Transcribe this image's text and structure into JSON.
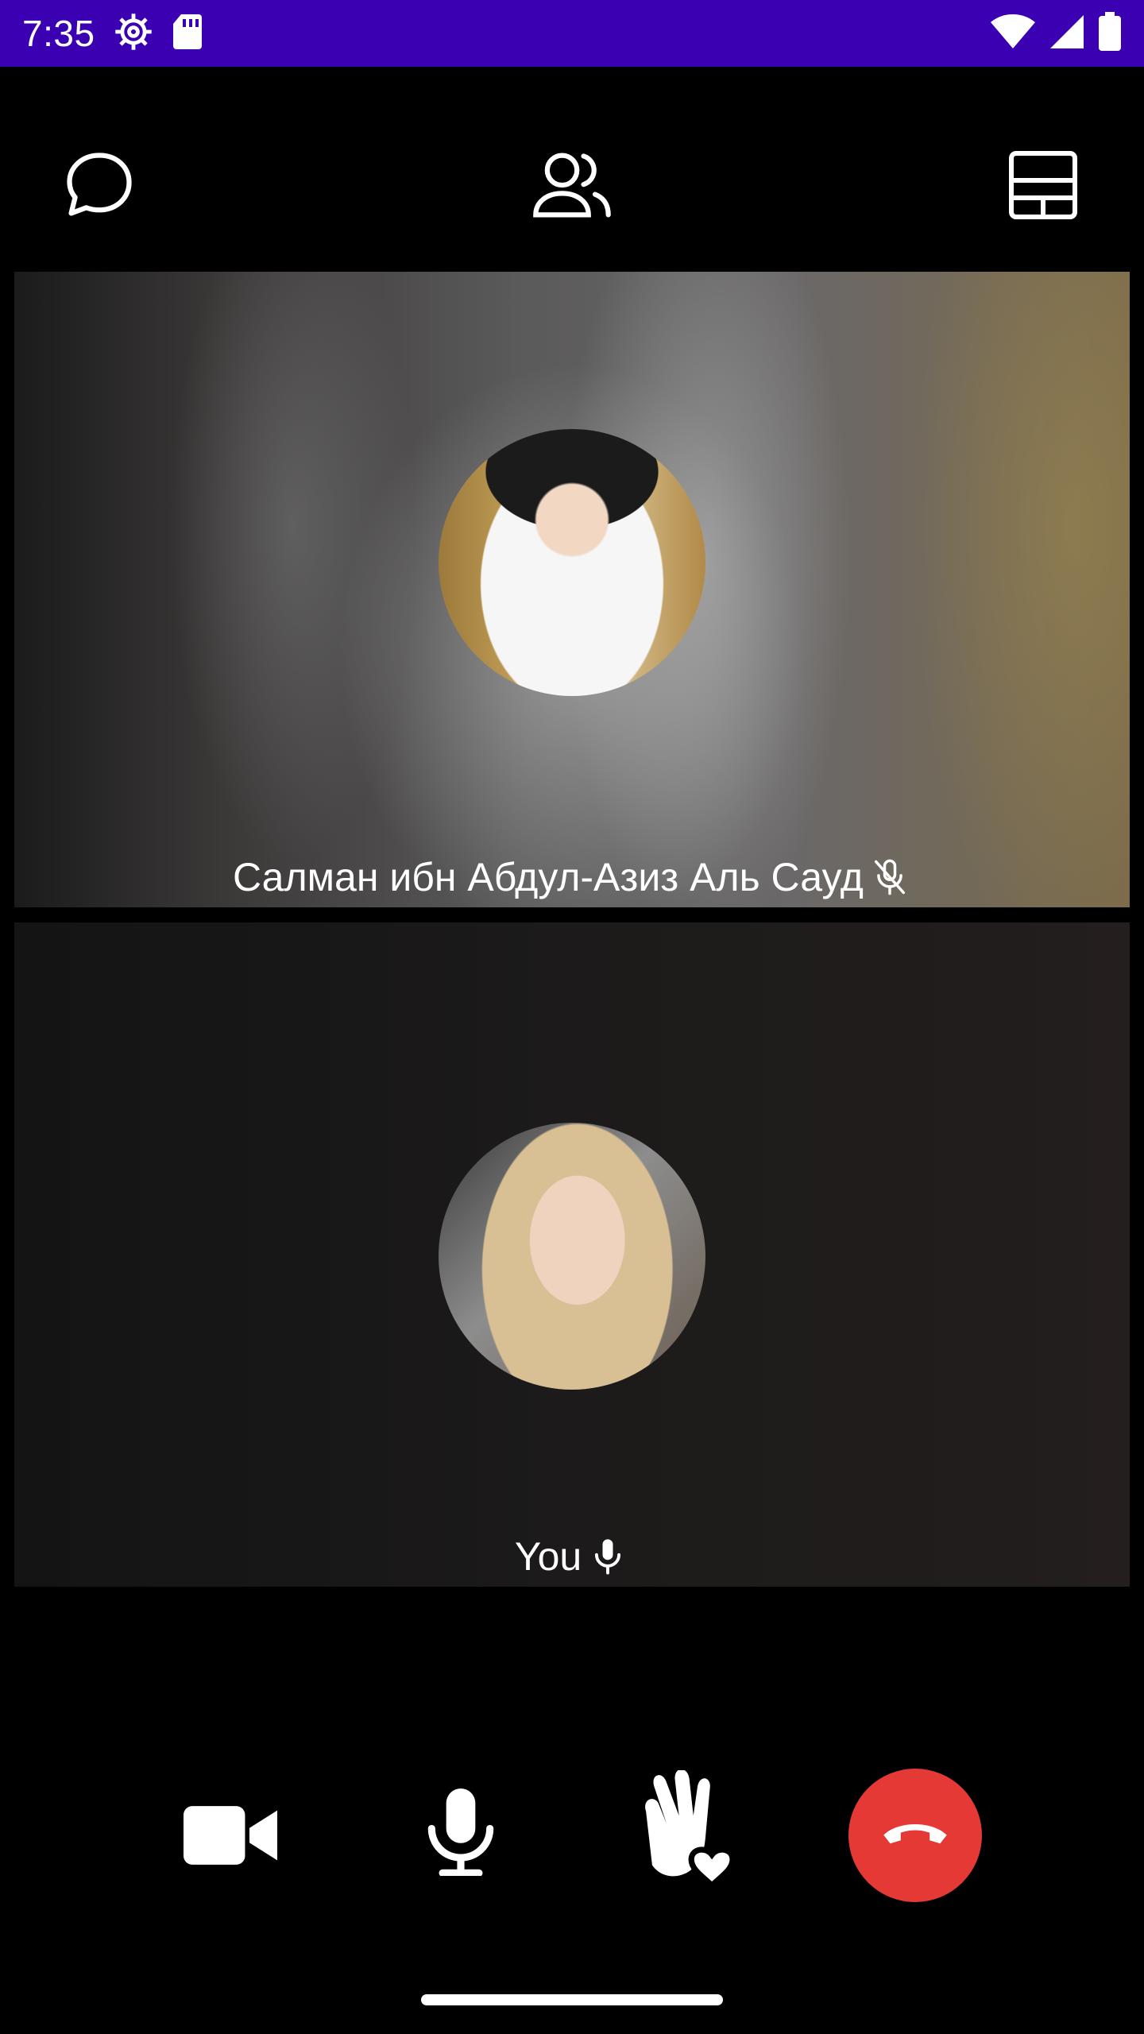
{
  "status": {
    "time": "7:35",
    "left_icons": [
      "settings-gear-icon",
      "sd-card-icon"
    ],
    "right_icons": [
      "wifi-icon",
      "cell-signal-icon",
      "battery-icon"
    ]
  },
  "topbar": {
    "buttons": [
      {
        "name": "chat",
        "icon": "chat-bubble-icon"
      },
      {
        "name": "participants",
        "icon": "participants-icon"
      },
      {
        "name": "layout",
        "icon": "grid-layout-icon"
      }
    ]
  },
  "tiles": {
    "remote": {
      "name": "Салман ибн Абдул-Азиз Аль Сауд",
      "mic_state": "muted",
      "mic_icon": "mic-off-icon"
    },
    "local": {
      "name": "You",
      "mic_state": "on",
      "mic_icon": "mic-icon"
    }
  },
  "controls": [
    {
      "name": "camera",
      "icon": "video-camera-icon"
    },
    {
      "name": "microphone",
      "icon": "mic-icon"
    },
    {
      "name": "raise-hand",
      "icon": "raise-hand-heart-icon"
    },
    {
      "name": "end-call",
      "icon": "hang-up-icon",
      "color": "#e53935"
    }
  ],
  "colors": {
    "status_bar": "#3a00b1",
    "background": "#000000",
    "end_call": "#e53935",
    "foreground": "#ffffff"
  }
}
